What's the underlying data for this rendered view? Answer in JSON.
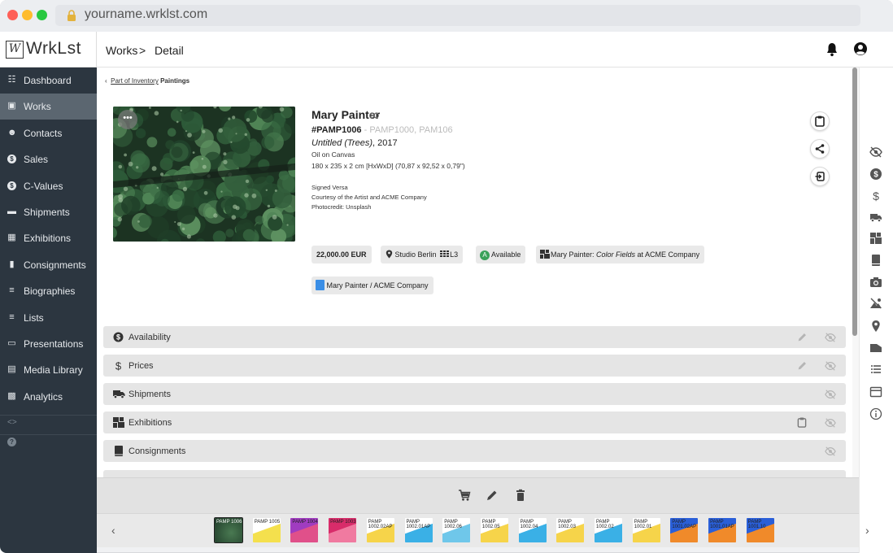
{
  "browser": {
    "url": "yourname.wrklst.com"
  },
  "app": {
    "logo_mark": "W",
    "logo_text": "WrkLst"
  },
  "sidebar": {
    "items": [
      {
        "label": "Dashboard",
        "icon": "grid-icon"
      },
      {
        "label": "Works",
        "icon": "image-icon",
        "active": true
      },
      {
        "label": "Contacts",
        "icon": "people-icon"
      },
      {
        "label": "Sales",
        "icon": "dollar-circle-icon"
      },
      {
        "label": "C-Values",
        "icon": "dollar-circle-icon"
      },
      {
        "label": "Shipments",
        "icon": "truck-icon"
      },
      {
        "label": "Exhibitions",
        "icon": "exhibition-icon"
      },
      {
        "label": "Consignments",
        "icon": "book-icon"
      },
      {
        "label": "Biographies",
        "icon": "list-icon"
      },
      {
        "label": "Lists",
        "icon": "list-icon"
      },
      {
        "label": "Presentations",
        "icon": "presentation-icon"
      },
      {
        "label": "Media Library",
        "icon": "media-icon"
      },
      {
        "label": "Analytics",
        "icon": "analytics-icon"
      }
    ],
    "mini": [
      "<>",
      "?"
    ]
  },
  "header": {
    "crumb_parent": "Works",
    "crumb_sep": ">",
    "crumb_current": "Detail"
  },
  "detail": {
    "back_prefix": "Part of Inventory",
    "back_name": "Paintings",
    "artist": "Mary Painter",
    "inventory_number": "#PAMP1006",
    "inventory_sep": " - ",
    "inventory_related": "PAMP1000, PAM106",
    "title": "Untitled (Trees)",
    "year": ", 2017",
    "medium": "Oil on Canvas",
    "dimensions": "180 x 235 x 2 cm [HxWxD] (70,87 x 92,52 x 0,79\")",
    "notes": [
      "Signed Versa",
      "Courtesy of the Artist and ACME Company",
      "Photocredit: Unsplash"
    ],
    "art_menu": "•••"
  },
  "tags": {
    "price": "22,000.00 EUR",
    "location": "Studio Berlin",
    "location_sub": "L3",
    "availability_letter": "A",
    "availability": "Available",
    "exhibition_prefix": "Mary Painter: ",
    "exhibition_title": "Color Fields",
    "exhibition_suffix": " at ACME Company",
    "consignment": "Mary Painter / ACME Company"
  },
  "sections": [
    {
      "label": "Availability",
      "icon": "dollar-circle-icon",
      "edit": true,
      "hide": true
    },
    {
      "label": "Prices",
      "icon": "dollar-icon",
      "edit": true,
      "hide": true
    },
    {
      "label": "Shipments",
      "icon": "truck-icon",
      "hide": true
    },
    {
      "label": "Exhibitions",
      "icon": "exhibition-icon",
      "clipboard": true,
      "hide": true
    },
    {
      "label": "Consignments",
      "icon": "book-icon",
      "hide": true
    }
  ],
  "filmstrip": [
    {
      "label": "PAMP 1006",
      "selected": true,
      "colors": [
        "#1e3a28",
        "#4a7a52"
      ]
    },
    {
      "label": "PAMP 1005",
      "colors": [
        "#ffffff",
        "#f4e04d"
      ]
    },
    {
      "label": "PAMP 1004",
      "colors": [
        "#a03cc0",
        "#e0508a"
      ]
    },
    {
      "label": "PAMP 1003",
      "colors": [
        "#d82c6a",
        "#f07aa0"
      ]
    },
    {
      "label": "PAMP 1002.02AP",
      "colors": [
        "#ffffff",
        "#f6d44a"
      ]
    },
    {
      "label": "PAMP 1002.01AP",
      "colors": [
        "#ffffff",
        "#3ab0e6"
      ]
    },
    {
      "label": "PAMP 1002.06",
      "colors": [
        "#ffffff",
        "#6fc7ea"
      ]
    },
    {
      "label": "PAMP 1002.05",
      "colors": [
        "#ffffff",
        "#f6d44a"
      ]
    },
    {
      "label": "PAMP 1002.04",
      "colors": [
        "#ffffff",
        "#3ab0e6"
      ]
    },
    {
      "label": "PAMP 1002.03",
      "colors": [
        "#ffffff",
        "#f6d44a"
      ]
    },
    {
      "label": "PAMP 1002.02",
      "colors": [
        "#ffffff",
        "#3ab0e6"
      ]
    },
    {
      "label": "PAMP 1002.01",
      "colors": [
        "#ffffff",
        "#f6d44a"
      ]
    },
    {
      "label": "PAMP 1001.02AP",
      "colors": [
        "#2a5fd8",
        "#f08a2a"
      ]
    },
    {
      "label": "PAMP 1001.01AP",
      "colors": [
        "#2a5fd8",
        "#f08a2a"
      ]
    },
    {
      "label": "PAMP 1001.10",
      "colors": [
        "#2a5fd8",
        "#f08a2a"
      ]
    }
  ],
  "colors": {
    "sidebar_bg": "#2c3640",
    "sidebar_active": "#5b6670",
    "available_green": "#3aa15a",
    "consignment_blue": "#3a8ee6"
  }
}
